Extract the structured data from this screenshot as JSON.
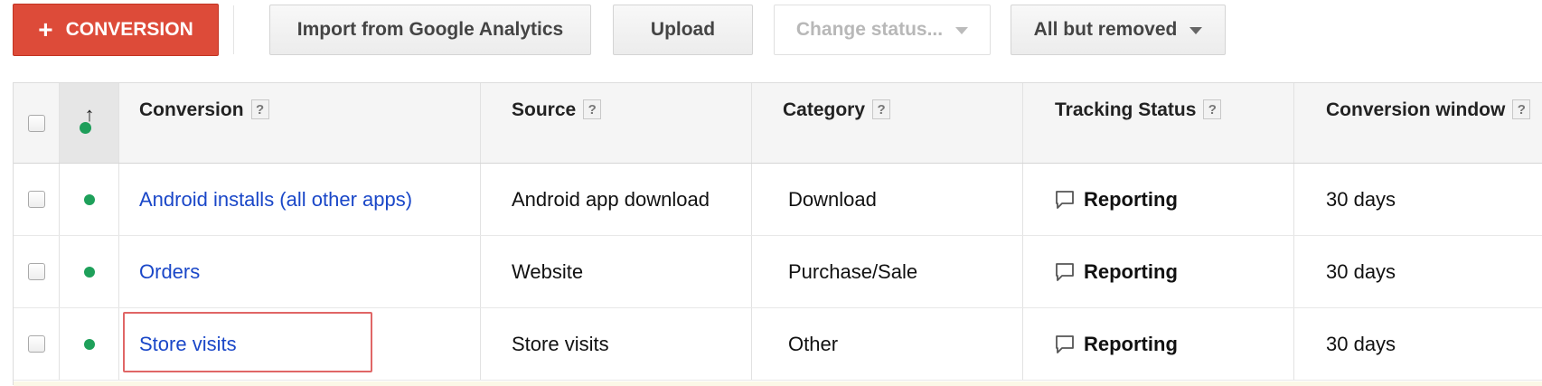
{
  "toolbar": {
    "add_conversion_label": "CONVERSION",
    "add_conversion_icon": "plus-icon",
    "import_label": "Import from Google Analytics",
    "upload_label": "Upload",
    "change_status_label": "Change status...",
    "filter_label": "All but removed"
  },
  "colors": {
    "primary_button": "#dd4b39",
    "link": "#1a47c8",
    "status_active": "#1ea05a",
    "highlight": "#e06666"
  },
  "table": {
    "columns": [
      {
        "key": "conversion",
        "label": "Conversion",
        "help": "?"
      },
      {
        "key": "source",
        "label": "Source",
        "help": "?"
      },
      {
        "key": "category",
        "label": "Category",
        "help": "?"
      },
      {
        "key": "tracking_status",
        "label": "Tracking Status",
        "help": "?"
      },
      {
        "key": "conversion_window",
        "label": "Conversion window",
        "help": "?"
      }
    ],
    "rows": [
      {
        "conversion": "Android installs (all other apps)",
        "source": "Android app download",
        "category": "Download",
        "tracking_status": "Reporting",
        "conversion_window": "30 days"
      },
      {
        "conversion": "Orders",
        "source": "Website",
        "category": "Purchase/Sale",
        "tracking_status": "Reporting",
        "conversion_window": "30 days"
      },
      {
        "conversion": "Store visits",
        "source": "Store visits",
        "category": "Other",
        "tracking_status": "Reporting",
        "conversion_window": "30 days"
      }
    ]
  }
}
